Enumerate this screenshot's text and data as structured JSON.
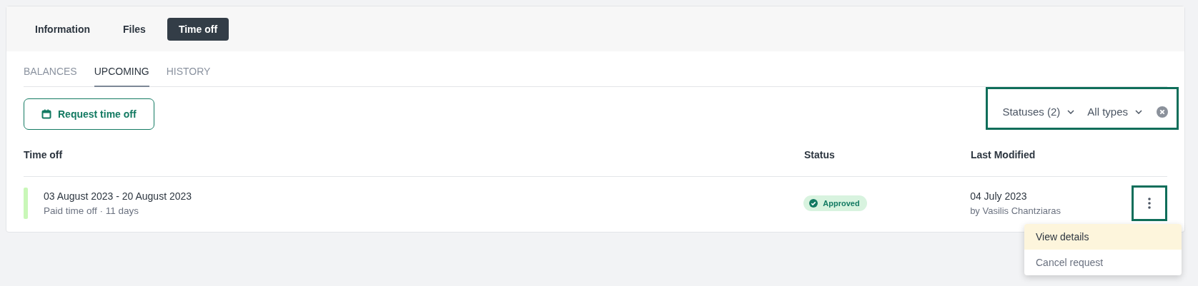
{
  "main_tabs": [
    {
      "label": "Information",
      "selected": false
    },
    {
      "label": "Files",
      "selected": false
    },
    {
      "label": "Time off",
      "selected": true
    }
  ],
  "sub_tabs": [
    {
      "label": "BALANCES",
      "selected": false
    },
    {
      "label": "UPCOMING",
      "selected": true
    },
    {
      "label": "HISTORY",
      "selected": false
    }
  ],
  "request_button": {
    "label": "Request time off"
  },
  "filters": {
    "highlighted": true,
    "items": [
      {
        "label": "Statuses (2)"
      },
      {
        "label": "All types"
      }
    ]
  },
  "table": {
    "columns": [
      "Time off",
      "Status",
      "Last Modified"
    ],
    "rows": [
      {
        "color": "#c9f7b8",
        "dates": "03 August 2023 - 20 August 2023",
        "detail": "Paid time off · 11 days",
        "status": "Approved",
        "modified": "04 July 2023",
        "modified_by": "by Vasilis Chantziaras",
        "menu_highlighted": true
      }
    ]
  },
  "menu": {
    "items": [
      {
        "label": "View details",
        "selected": true
      },
      {
        "label": "Cancel request",
        "selected": false
      }
    ]
  }
}
